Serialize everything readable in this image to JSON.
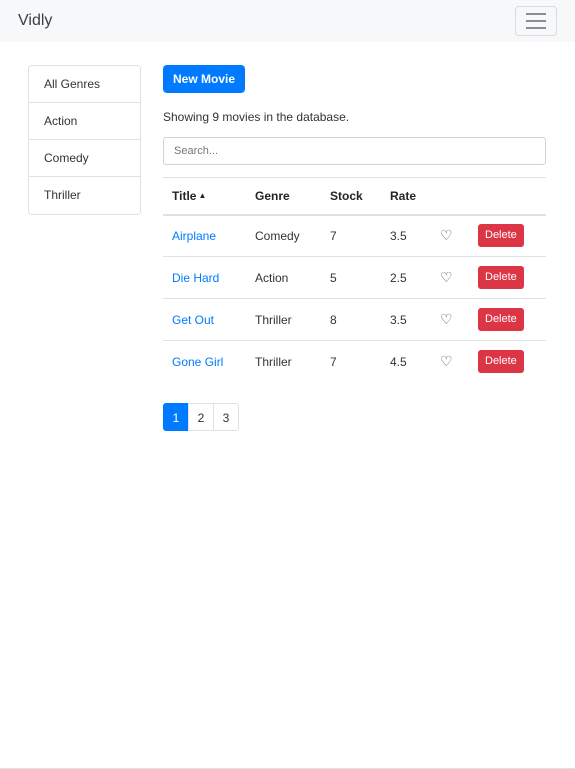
{
  "navbar": {
    "brand": "Vidly",
    "toggle_icon": "hamburger-menu-icon"
  },
  "sidebar": {
    "genres": [
      {
        "label": "All Genres"
      },
      {
        "label": "Action"
      },
      {
        "label": "Comedy"
      },
      {
        "label": "Thriller"
      }
    ]
  },
  "main": {
    "new_movie_label": "New Movie",
    "count_text": "Showing 9 movies in the database.",
    "search_placeholder": "Search...",
    "columns": {
      "title": "Title",
      "genre": "Genre",
      "stock": "Stock",
      "rate": "Rate"
    },
    "sort_icon": "caret-up-icon",
    "movies": [
      {
        "title": "Airplane",
        "genre": "Comedy",
        "stock": "7",
        "rate": "3.5",
        "delete_label": "Delete"
      },
      {
        "title": "Die Hard",
        "genre": "Action",
        "stock": "5",
        "rate": "2.5",
        "delete_label": "Delete"
      },
      {
        "title": "Get Out",
        "genre": "Thriller",
        "stock": "8",
        "rate": "3.5",
        "delete_label": "Delete"
      },
      {
        "title": "Gone Girl",
        "genre": "Thriller",
        "stock": "7",
        "rate": "4.5",
        "delete_label": "Delete"
      }
    ],
    "pages": [
      {
        "label": "1"
      },
      {
        "label": "2"
      },
      {
        "label": "3"
      }
    ],
    "active_page": "1"
  },
  "colors": {
    "primary": "#007bff",
    "danger": "#dc3545",
    "navbar_bg": "#f7f8fa"
  }
}
